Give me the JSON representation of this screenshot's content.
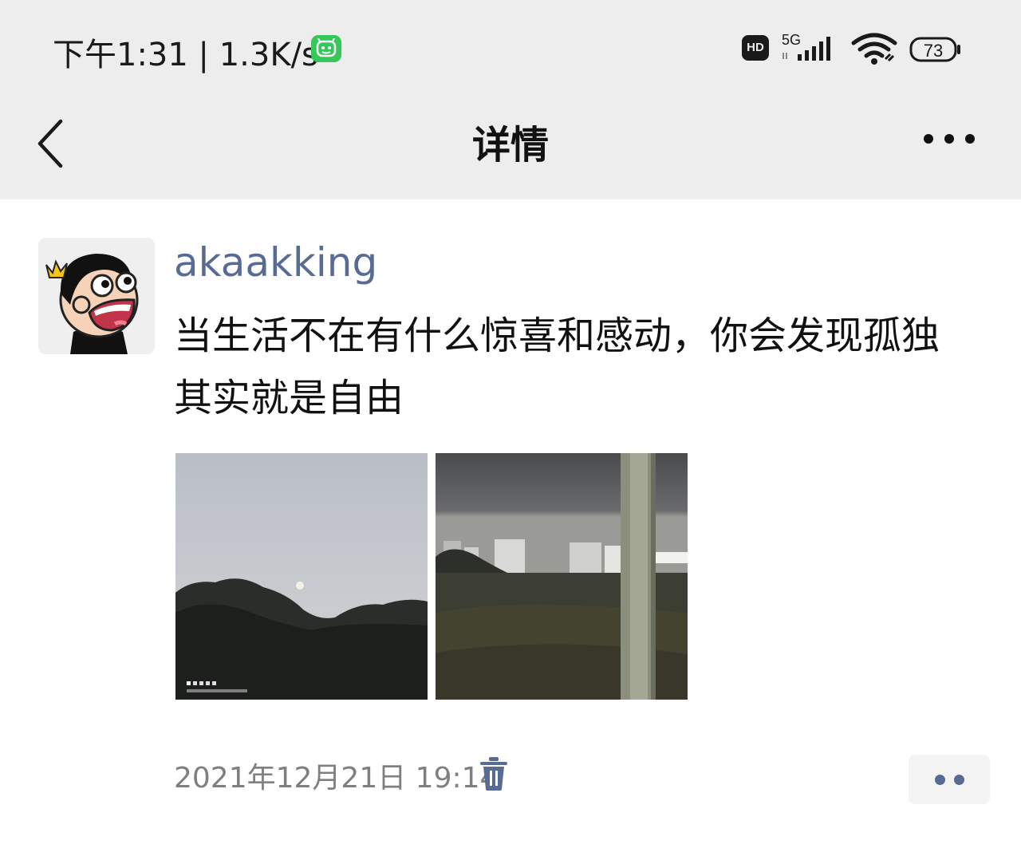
{
  "status_bar": {
    "time_and_speed": "下午1:31 | 1.3K/s",
    "hd_label": "HD",
    "network_label": "5G",
    "battery_level": "73"
  },
  "nav": {
    "title": "详情",
    "back_icon": "chevron-left-icon",
    "more_icon": "ellipsis-icon"
  },
  "post": {
    "username": "akaakking",
    "text": "当生活不在有什么惊喜和感动，你会发现孤独其实就是自由",
    "timestamp": "2021年12月21日 19:14"
  },
  "colors": {
    "link_blue": "#576b95",
    "header_bg": "#ededed"
  }
}
